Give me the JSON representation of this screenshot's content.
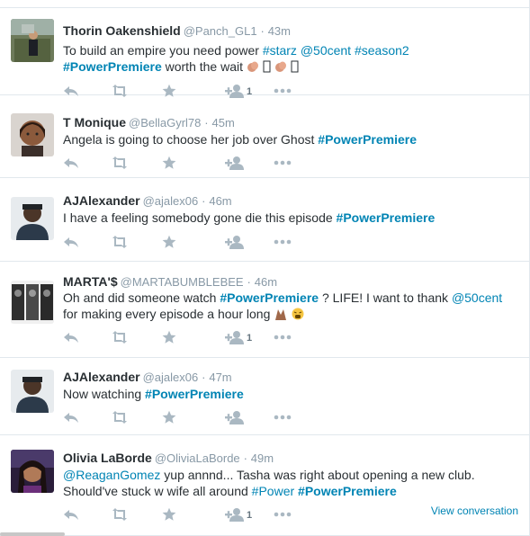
{
  "tweets": [
    {
      "fullname": "Thorin Oakenshield",
      "handle": "@Panch_GL1",
      "time": "43m",
      "dot": "·",
      "lines": [
        [
          {
            "t": "To build an empire you need power "
          },
          {
            "t": "#starz",
            "link": true
          },
          {
            "t": " "
          },
          {
            "t": "@50cent",
            "link": true
          },
          {
            "t": " "
          },
          {
            "t": "#season2",
            "link": true
          }
        ],
        [
          {
            "t": "#PowerPremiere",
            "link": true,
            "bold": true
          },
          {
            "t": " worth the wait "
          },
          {
            "emoji": "clap"
          },
          {
            "emoji": "box"
          },
          {
            "emoji": "clap"
          },
          {
            "emoji": "box"
          }
        ]
      ],
      "favorite_count": "1"
    },
    {
      "fullname": "T Monique",
      "handle": "@BellaGyrl78",
      "time": "45m",
      "dot": "·",
      "lines": [
        [
          {
            "t": "Angela is going to choose her job over Ghost "
          },
          {
            "t": "#PowerPremiere",
            "link": true,
            "bold": true
          }
        ]
      ],
      "favorite_count": ""
    },
    {
      "fullname": "AJAlexander",
      "handle": "@ajalex06",
      "time": "46m",
      "dot": "·",
      "lines": [
        [
          {
            "t": "I have a feeling somebody gone die this episode "
          },
          {
            "t": "#PowerPremiere",
            "link": true,
            "bold": true
          }
        ]
      ],
      "favorite_count": ""
    },
    {
      "fullname": "MARTA'$",
      "handle": "@MARTABUMBLEBEE",
      "time": "46m",
      "dot": "·",
      "lines": [
        [
          {
            "t": "Oh and did someone watch "
          },
          {
            "t": "#PowerPremiere",
            "link": true,
            "bold": true
          },
          {
            "t": " ? LIFE! I want to thank "
          },
          {
            "t": "@50cent",
            "link": true
          }
        ],
        [
          {
            "t": "for making every episode a hour long "
          },
          {
            "emoji": "pray"
          },
          {
            "emoji": "tired"
          }
        ]
      ],
      "favorite_count": "1"
    },
    {
      "fullname": "AJAlexander",
      "handle": "@ajalex06",
      "time": "47m",
      "dot": "·",
      "lines": [
        [
          {
            "t": "Now watching "
          },
          {
            "t": "#PowerPremiere",
            "link": true,
            "bold": true
          }
        ]
      ],
      "favorite_count": ""
    },
    {
      "fullname": "Olivia LaBorde",
      "handle": "@OliviaLaBorde",
      "time": "49m",
      "dot": "·",
      "lines": [
        [
          {
            "t": "@ReaganGomez",
            "link": true
          },
          {
            "t": " yup annnd... Tasha was right about opening a new club."
          }
        ],
        [
          {
            "t": "Should've stuck w wife all around "
          },
          {
            "t": "#Power",
            "link": true
          },
          {
            "t": " "
          },
          {
            "t": "#PowerPremiere",
            "link": true,
            "bold": true
          }
        ]
      ],
      "favorite_count": "1"
    }
  ],
  "view_conversation": "View conversation",
  "icons": {
    "reply": "reply-icon",
    "retweet": "retweet-icon",
    "favorite": "star-icon",
    "follow": "follow-user-icon",
    "more": "more-options-icon"
  },
  "colors": {
    "link": "#0084b4",
    "action_icon": "#aab8c2",
    "muted": "#8899a6"
  }
}
